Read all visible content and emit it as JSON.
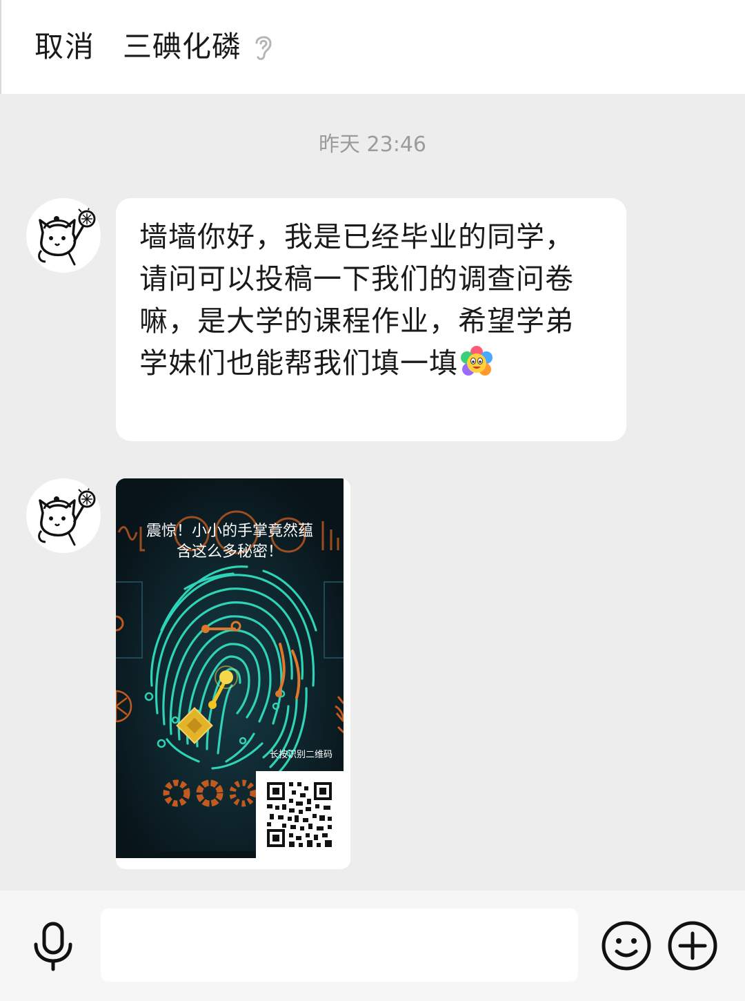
{
  "header": {
    "cancel_label": "取消",
    "contact_name": "三碘化磷",
    "mode_icon": "ear-icon"
  },
  "chat": {
    "timestamp": "昨天 23:46",
    "messages": [
      {
        "type": "text",
        "text": "墙墙你好，我是已经毕业的同学，请问可以投稿一下我们的调查问卷嘛，是大学的课程作业，希望学弟学妹们也能帮我们填一填",
        "trailing_emoji": "flower-face-emoji"
      },
      {
        "type": "image",
        "poster_title_line1": "震惊！小小的手掌竟然蕴",
        "poster_title_line2": "含这么多秘密！",
        "poster_caption": "长按识别二维码",
        "image_subject": "fingerprint-circuit-icon"
      }
    ]
  },
  "input_bar": {
    "input_value": "",
    "voice_icon": "microphone-icon",
    "emoji_icon": "smiley-icon",
    "more_icon": "plus-circle-icon"
  },
  "colors": {
    "background": "#ededed",
    "bubble": "#ffffff",
    "poster_bg": "#0c1e26",
    "fingerprint": "#2fd3b7",
    "accent_orange": "#e0782c"
  }
}
